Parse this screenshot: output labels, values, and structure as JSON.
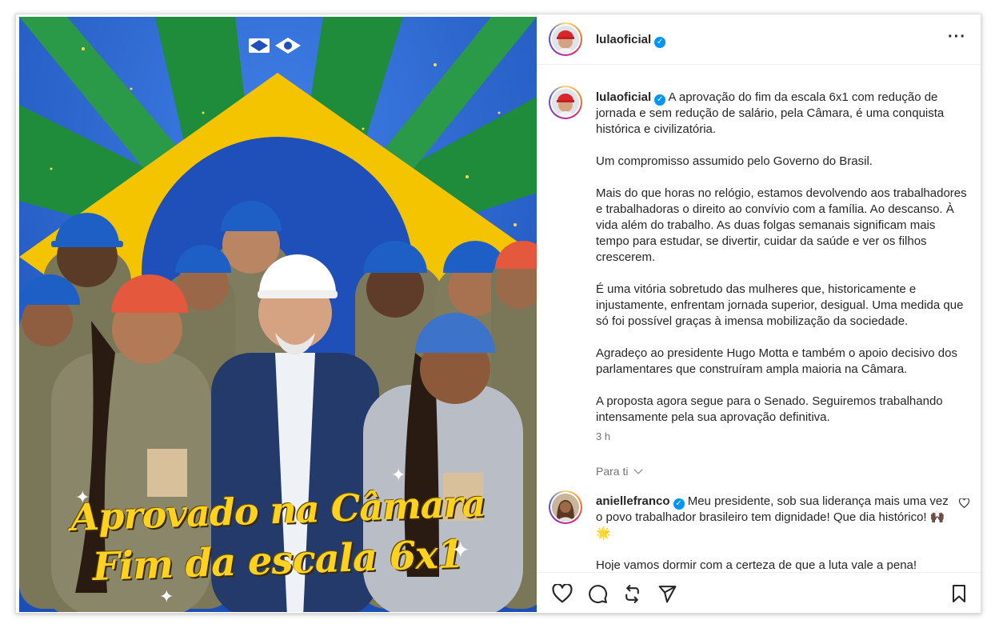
{
  "image": {
    "overlay_line1": "Aprovado na Câmara",
    "overlay_line2": "Fim da escala 6x1"
  },
  "header": {
    "username": "lulaoficial",
    "more_icon": "more-horizontal-icon",
    "verified_icon": "verified-badge-icon"
  },
  "caption": {
    "username": "lulaoficial",
    "paragraphs": [
      "A aprovação do fim da escala 6x1 com redução de jornada e sem redução de salário, pela Câmara, é uma conquista histórica e civilizatória.",
      "Um compromisso assumido pelo Governo do Brasil.",
      "Mais do que horas no relógio, estamos devolvendo aos trabalhadores e trabalhadoras o direito ao convívio com a família. Ao descanso. À vida além do trabalho. As duas folgas semanais significam mais tempo para estudar, se divertir, cuidar da saúde e ver os filhos crescerem.",
      "É uma vitória sobretudo das mulheres que, historicamente e injustamente, enfrentam jornada superior, desigual. Uma medida que só foi possível graças à imensa mobilização da sociedade.",
      "Agradeço ao presidente Hugo Motta e também o apoio decisivo dos parlamentares que construíram ampla maioria na Câmara.",
      "A proposta agora segue para o Senado. Seguiremos trabalhando intensamente pela sua aprovação definitiva."
    ],
    "time": "3 h"
  },
  "for_you_label": "Para ti",
  "comment": {
    "username": "aniellefranco",
    "text_first": "Meu presidente, sob sua liderança mais uma vez o povo trabalhador brasileiro tem dignidade! Que dia histórico! 🙌🏿🌟",
    "text_second": "Hoje vamos dormir com a certeza de que a luta vale a pena!"
  },
  "actions": {
    "like_icon": "heart-icon",
    "comment_icon": "comment-icon",
    "repost_icon": "repost-icon",
    "share_icon": "send-icon",
    "save_icon": "bookmark-icon"
  },
  "colors": {
    "brazil_green": "#1e8c3a",
    "brazil_yellow": "#f5c400",
    "brazil_blue": "#1f4fb8",
    "verified_blue": "#0095f6"
  }
}
